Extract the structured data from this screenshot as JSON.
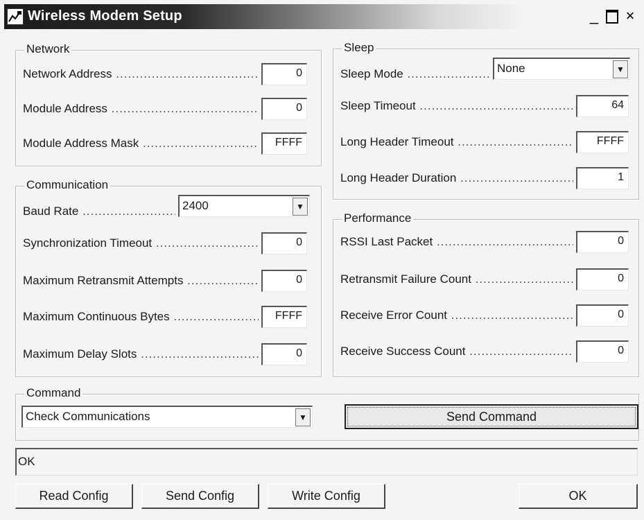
{
  "window": {
    "title": "Wireless Modem Setup",
    "icon": "modem-setup-icon",
    "controls": {
      "minimize": "_",
      "close": "×"
    }
  },
  "network": {
    "legend": "Network",
    "fields": [
      {
        "label": "Network Address",
        "value": "0"
      },
      {
        "label": "Module Address",
        "value": "0"
      },
      {
        "label": "Module Address Mask",
        "value": "FFFF"
      }
    ]
  },
  "communication": {
    "legend": "Communication",
    "baud_rate": {
      "label": "Baud Rate",
      "value": "2400"
    },
    "fields": [
      {
        "label": "Synchronization Timeout",
        "value": "0"
      },
      {
        "label": "Maximum Retransmit Attempts",
        "value": "0"
      },
      {
        "label": "Maximum Continuous Bytes",
        "value": "FFFF"
      },
      {
        "label": "Maximum Delay Slots",
        "value": "0"
      }
    ]
  },
  "sleep": {
    "legend": "Sleep",
    "sleep_mode": {
      "label": "Sleep Mode",
      "value": "None"
    },
    "fields": [
      {
        "label": "Sleep Timeout",
        "value": "64"
      },
      {
        "label": "Long Header Timeout",
        "value": "FFFF"
      },
      {
        "label": "Long Header Duration",
        "value": "1"
      }
    ]
  },
  "performance": {
    "legend": "Performance",
    "fields": [
      {
        "label": "RSSI Last Packet",
        "value": "0"
      },
      {
        "label": "Retransmit Failure Count",
        "value": "0"
      },
      {
        "label": "Receive Error Count",
        "value": "0"
      },
      {
        "label": "Receive Success Count",
        "value": "0"
      }
    ]
  },
  "command": {
    "legend": "Command",
    "selected": "Check Communications",
    "send_label": "Send Command"
  },
  "status": {
    "text": "OK"
  },
  "buttons": {
    "read_config": "Read Config",
    "send_config": "Send Config",
    "write_config": "Write Config",
    "ok": "OK"
  },
  "colors": {
    "titlebar_dark": "#1c1c1c",
    "window_bg": "#f4f4f4"
  }
}
